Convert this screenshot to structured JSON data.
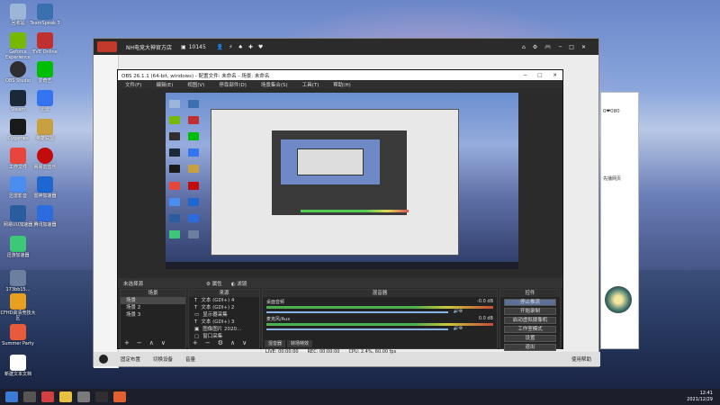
{
  "desktop": {
    "icons": [
      {
        "label": "回收站",
        "color": "#9db6d8"
      },
      {
        "label": "TeamSpeak 3",
        "color": "#3a6fb0"
      },
      {
        "label": "Geforce Experience",
        "color": "#76b900"
      },
      {
        "label": "EVE Online",
        "color": "#c03030"
      },
      {
        "label": "OBS Studio",
        "color": "#302e31"
      },
      {
        "label": "爱奇艺",
        "color": "#00be06"
      },
      {
        "label": "Steam",
        "color": "#1b2838"
      },
      {
        "label": "迅雷",
        "color": "#3574f0"
      },
      {
        "label": "Cygames",
        "color": "#1a1a1a"
      },
      {
        "label": "英雄联盟",
        "color": "#c8a040"
      },
      {
        "label": "工作文件",
        "color": "#e8453c"
      },
      {
        "label": "网易云音乐",
        "color": "#c20c0c"
      },
      {
        "label": "迅雷影音",
        "color": "#4a8df0"
      },
      {
        "label": "雷神加速器",
        "color": "#1e66d0"
      },
      {
        "label": "网易UU加速器",
        "color": "#2a5d9f"
      },
      {
        "label": "腾讯加速器",
        "color": "#2d6cdf"
      },
      {
        "label": "迅游加速器",
        "color": "#3dc878"
      },
      {
        "label": "173bb15...",
        "color": "#6d7f9e"
      },
      {
        "label": "CFHD高清竞技大区",
        "color": "#e8a020"
      },
      {
        "label": "Summer Party",
        "color": "#e85a3a"
      },
      {
        "label": "新建文本文档",
        "color": "#ffffff"
      }
    ]
  },
  "taskbar": {
    "time": "12:41",
    "date": "2021/12/29"
  },
  "host_window": {
    "title": "NH电竞大神官方店",
    "count": "10145"
  },
  "chat": {
    "snippet": "0❤080",
    "line": "先播网页"
  },
  "obs": {
    "title": "OBS 26.1.1 (64-bit, windows) - 配置文件: 未命名 - 场景: 未命名",
    "menu": [
      "文件(F)",
      "编辑(E)",
      "视图(V)",
      "停靠部件(D)",
      "场景集合(S)",
      "工具(T)",
      "帮助(H)"
    ],
    "source_label": "未选择源",
    "props_button": "属性",
    "filters_button": "滤镜",
    "scenes_header": "场景",
    "scenes": [
      "场景",
      "场景 2",
      "场景 3"
    ],
    "sources_header": "来源",
    "sources": [
      "文本 (GDI+) 4",
      "文本 (GDI+) 2",
      "显示器采集",
      "文本 (GDI+) 3",
      "图像图片 2020...",
      "窗口采集"
    ],
    "mixer_header": "混音器",
    "mixer": [
      {
        "name": "桌面音频",
        "db": "-0.0 dB"
      },
      {
        "name": "麦克风/Aux",
        "db": "0.0 dB"
      }
    ],
    "mixer_tabs": [
      "混音器",
      "转场特效"
    ],
    "controls_header": "控件",
    "controls": [
      "停止推流",
      "开始录制",
      "启动虚拟摄像机",
      "工作室模式",
      "设置",
      "退出"
    ],
    "status": [
      "LIVE: 00:00:00",
      "REC: 00:00:00",
      "CPU: 2.4%, 60.00 fps"
    ]
  },
  "host_footer": [
    "固定布置",
    "切换设备",
    "音量"
  ],
  "host_footer_right": "使用帮助"
}
